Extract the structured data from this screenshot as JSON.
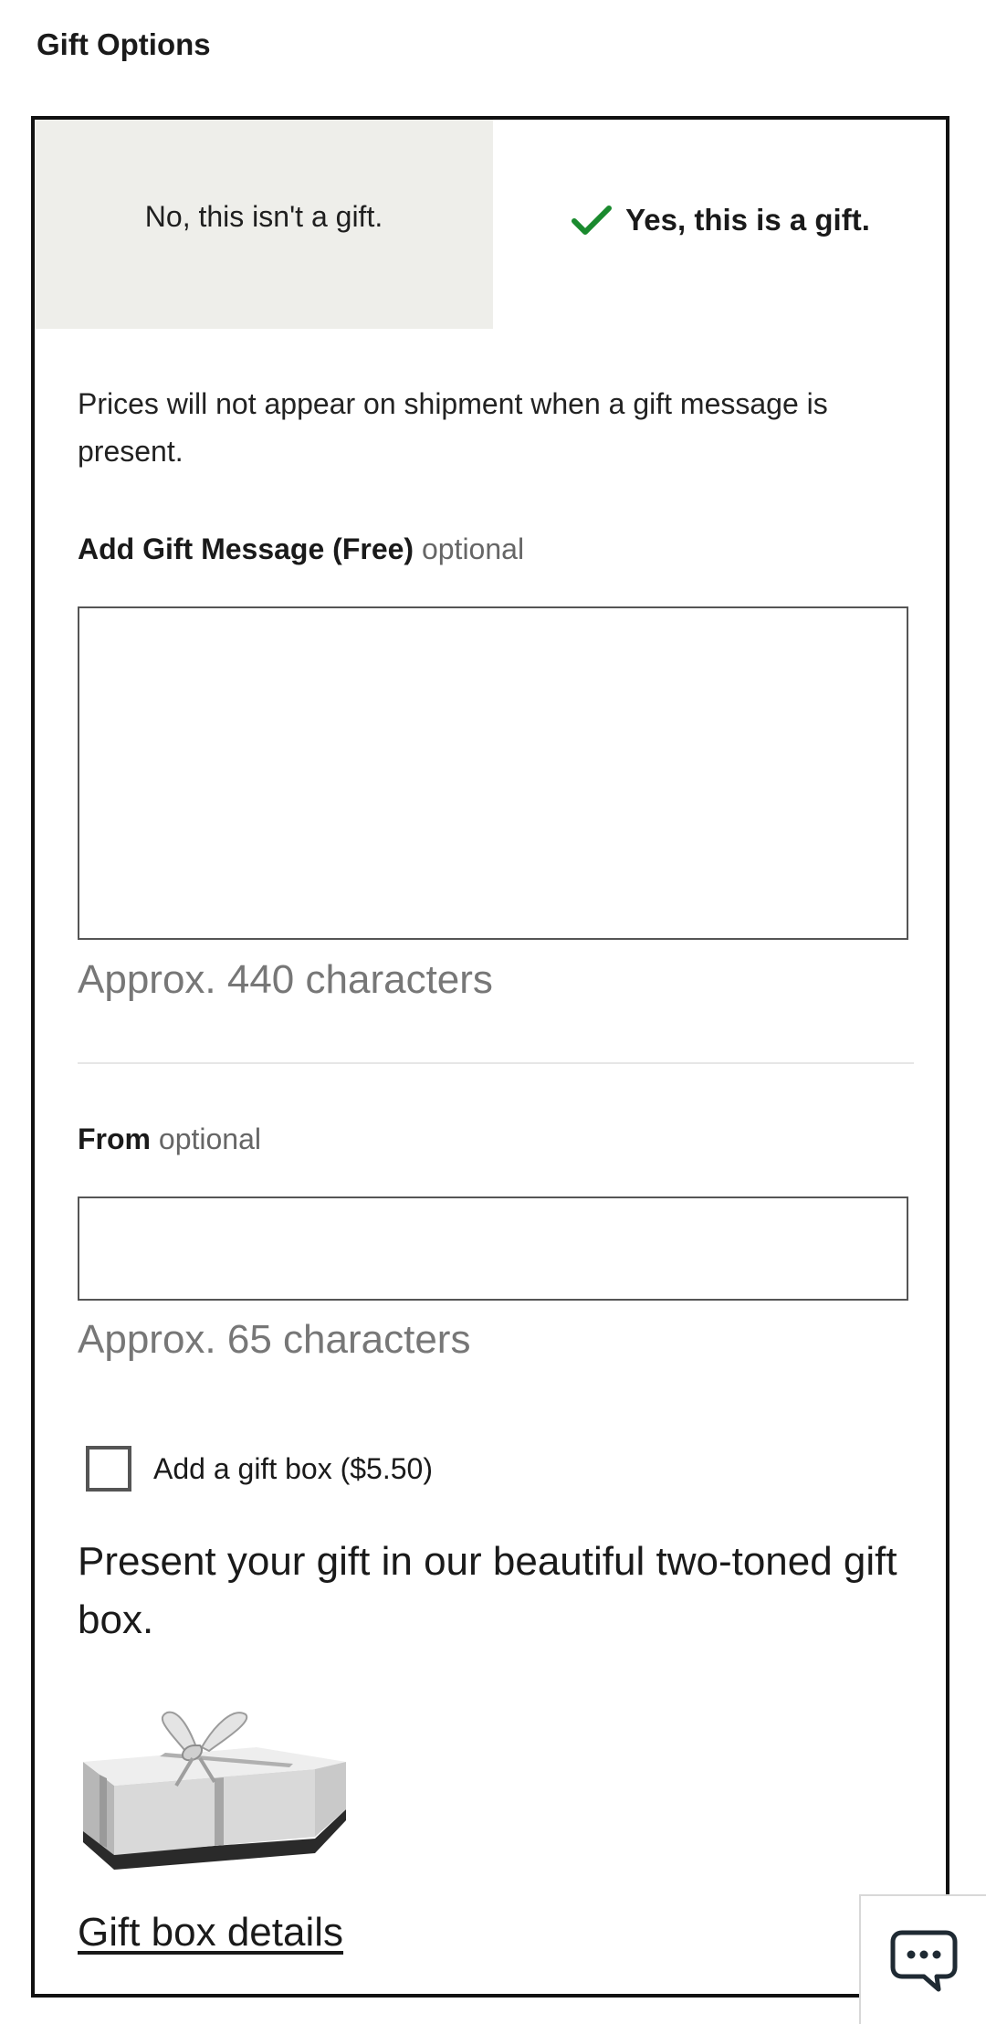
{
  "page": {
    "title": "Gift Options"
  },
  "gift_toggle": {
    "no_label": "No, this isn't a gift.",
    "yes_label": "Yes, this is a gift.",
    "selected": "yes"
  },
  "info": {
    "prices_note": "Prices will not appear on shipment when a gift message is present."
  },
  "gift_message": {
    "label": "Add Gift Message (Free)",
    "optional": "optional",
    "value": "",
    "hint": "Approx. 440 characters"
  },
  "from": {
    "label": "From",
    "optional": "optional",
    "value": "",
    "hint": "Approx. 65 characters"
  },
  "gift_box": {
    "checkbox_label": "Add a gift box ($5.50)",
    "checked": false,
    "description": "Present your gift in our beautiful two-toned gift box.",
    "image_icon": "gift-box-image",
    "details_link": "Gift box details"
  },
  "chat": {
    "icon": "chat-bubble-icon"
  },
  "colors": {
    "check_green": "#1a8a2e",
    "toggle_unselected_bg": "#eeeeea",
    "panel_border": "#111111",
    "muted_text": "#777777"
  }
}
